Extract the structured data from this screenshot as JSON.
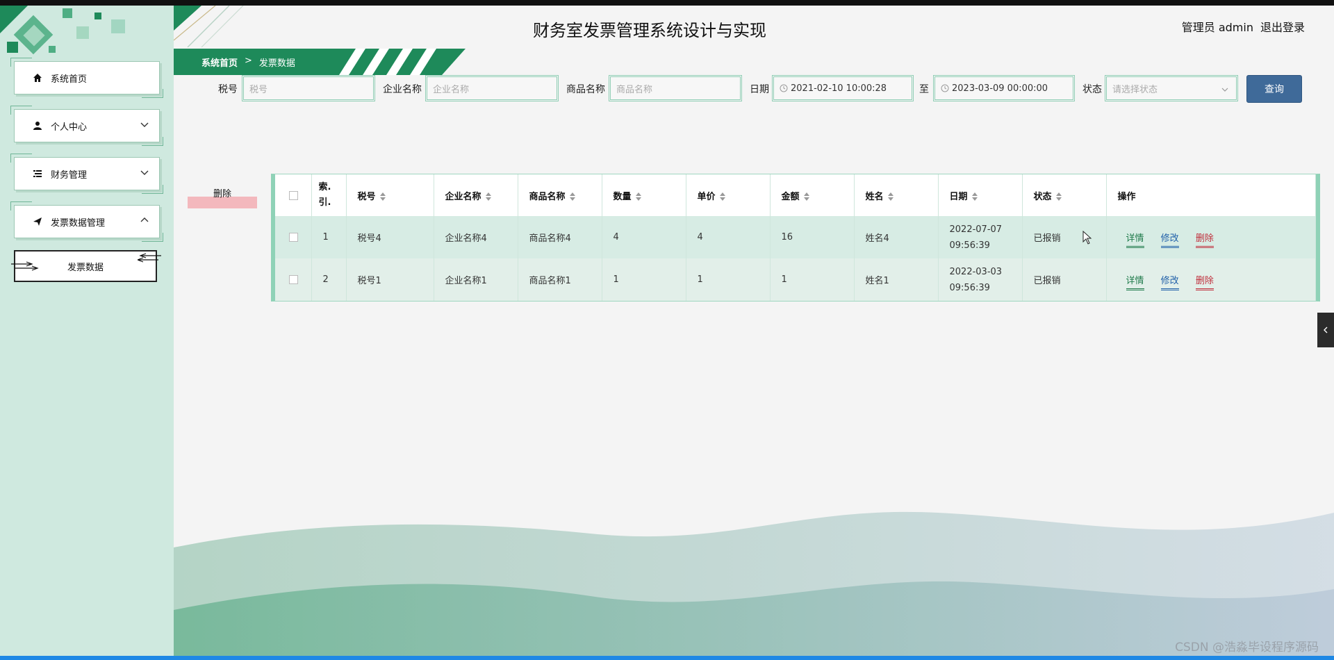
{
  "app": {
    "title": "财务室发票管理系统设计与实现",
    "user_label": "管理员 admin",
    "logout_label": "退出登录"
  },
  "breadcrumb": {
    "home": "系统首页",
    "separator": ">",
    "current": "发票数据"
  },
  "sidebar": {
    "items": [
      {
        "label": "系统首页",
        "icon": "home-icon"
      },
      {
        "label": "个人中心",
        "icon": "user-icon"
      },
      {
        "label": "财务管理",
        "icon": "list-icon"
      },
      {
        "label": "发票数据管理",
        "icon": "send-icon"
      }
    ],
    "sub_item": "发票数据"
  },
  "filters": {
    "tax_label": "税号",
    "tax_placeholder": "税号",
    "company_label": "企业名称",
    "company_placeholder": "企业名称",
    "product_label": "商品名称",
    "product_placeholder": "商品名称",
    "date_label": "日期",
    "date_from": "2021-02-10 10:00:28",
    "date_to_label": "至",
    "date_to": "2023-03-09 00:00:00",
    "status_label": "状态",
    "status_placeholder": "请选择状态",
    "query_button": "查询"
  },
  "actions": {
    "delete_button": "删除"
  },
  "table": {
    "headers": [
      "索引",
      "税号",
      "企业名称",
      "商品名称",
      "数量",
      "单价",
      "金额",
      "姓名",
      "日期",
      "状态",
      "操作"
    ],
    "index_header_line1": "索.",
    "index_header_line2": "引.",
    "rows": [
      {
        "index": "1",
        "tax_no": "税号4",
        "company": "企业名称4",
        "product": "商品名称4",
        "qty": "4",
        "price": "4",
        "amount": "16",
        "name": "姓名4",
        "date_line1": "2022-07-07",
        "date_line2": "09:56:39",
        "status": "已报销"
      },
      {
        "index": "2",
        "tax_no": "税号1",
        "company": "企业名称1",
        "product": "商品名称1",
        "qty": "1",
        "price": "1",
        "amount": "1",
        "name": "姓名1",
        "date_line1": "2022-03-03",
        "date_line2": "09:56:39",
        "status": "已报销"
      }
    ],
    "row_actions": {
      "detail": "详情",
      "edit": "修改",
      "delete": "删除"
    }
  },
  "watermark": "CSDN @浩淼毕设程序源码",
  "colors": {
    "sidebar_bg": "#cfe9df",
    "brand_green": "#1e8a5a",
    "query_blue": "#3f6a99",
    "delete_red": "#c0303d"
  }
}
